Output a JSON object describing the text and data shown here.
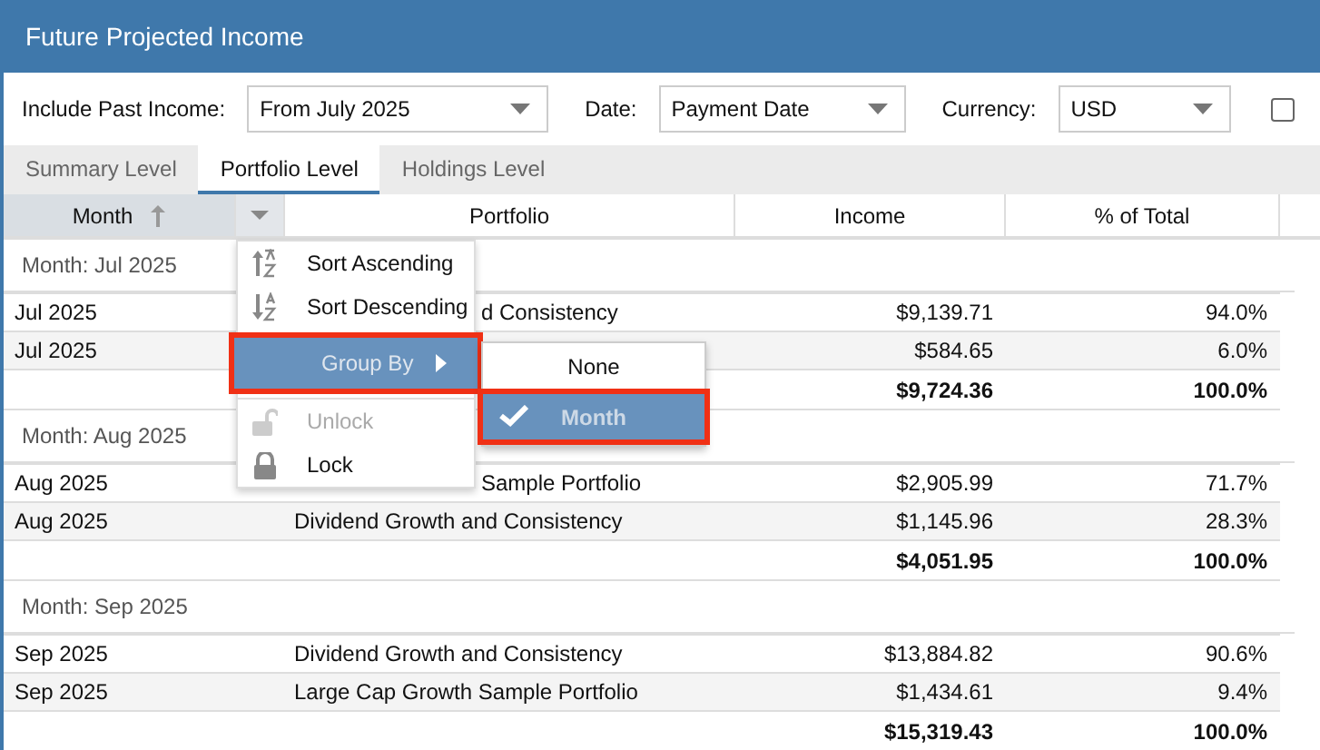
{
  "title": "Future Projected Income",
  "filters": [
    {
      "label": "Include Past Income:",
      "value": "From July 2025"
    },
    {
      "label": "Date:",
      "value": "Payment Date"
    },
    {
      "label": "Currency:",
      "value": "USD"
    }
  ],
  "checkbox": {
    "checked": false
  },
  "tabs": [
    {
      "label": "Summary Level",
      "selected": false
    },
    {
      "label": "Portfolio Level",
      "selected": true
    },
    {
      "label": "Holdings Level",
      "selected": false
    }
  ],
  "columns": [
    "Month",
    "Portfolio",
    "Income",
    "% of Total"
  ],
  "groups": [
    {
      "header": "Month: Jul 2025",
      "rows": [
        {
          "month": "Jul 2025",
          "portfolio": "d Consistency",
          "kind": "covered",
          "income": "$9,139.71",
          "share": "94.0%"
        },
        {
          "month": "Jul 2025",
          "kind": "covered",
          "income": "$584.65",
          "share": "6.0%"
        }
      ],
      "total": {
        "income": "$9,724.36",
        "share": "100.0%"
      }
    },
    {
      "header": "Month: Aug 2025",
      "rows": [
        {
          "month": "Aug 2025",
          "portfolio": "Sample Portfolio",
          "kind": "covered",
          "income": "$2,905.99",
          "share": "71.7%"
        },
        {
          "month": "Aug 2025",
          "portfolio": "Dividend Growth and Consistency",
          "kind": "plain",
          "income": "$1,145.96",
          "share": "28.3%"
        }
      ],
      "total": {
        "income": "$4,051.95",
        "share": "100.0%"
      }
    },
    {
      "header": "Month: Sep 2025",
      "rows": [
        {
          "month": "Sep 2025",
          "portfolio": "Dividend Growth and Consistency",
          "kind": "plain",
          "income": "$13,884.82",
          "share": "90.6%"
        },
        {
          "month": "Sep 2025",
          "portfolio": "Large Cap Growth Sample Portfolio",
          "kind": "plain",
          "income": "$1,434.61",
          "share": "9.4%"
        }
      ],
      "total": {
        "income": "$15,319.43",
        "share": "100.0%"
      }
    }
  ],
  "column_menu": [
    {
      "kind": "sort-asc",
      "label": "Sort Ascending",
      "selected": false,
      "disabled": false,
      "outlined": false
    },
    {
      "kind": "sort-desc",
      "label": "Sort Descending",
      "selected": false,
      "disabled": false,
      "outlined": false
    },
    {
      "kind": "group",
      "label": "Group By",
      "selected": true,
      "disabled": false,
      "outlined": true
    },
    {
      "kind": "unlock",
      "label": "Unlock",
      "selected": false,
      "disabled": true,
      "outlined": false
    },
    {
      "kind": "lock",
      "label": "Lock",
      "selected": false,
      "disabled": false,
      "outlined": false
    }
  ],
  "submenu": [
    {
      "label": "None",
      "selected": false,
      "outlined": false
    },
    {
      "label": "Month",
      "selected": true,
      "outlined": true
    }
  ]
}
